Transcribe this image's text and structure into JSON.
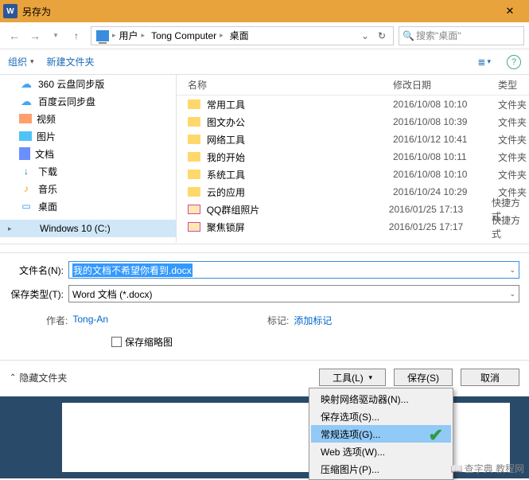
{
  "title": "另存为",
  "breadcrumb": {
    "items": [
      "用户",
      "Tong Computer",
      "桌面"
    ]
  },
  "search": {
    "placeholder": "搜索\"桌面\""
  },
  "toolbar": {
    "organize": "组织",
    "newfolder": "新建文件夹"
  },
  "tree": {
    "items": [
      {
        "label": "360 云盘同步版"
      },
      {
        "label": "百度云同步盘"
      },
      {
        "label": "视频"
      },
      {
        "label": "图片"
      },
      {
        "label": "文档"
      },
      {
        "label": "下载"
      },
      {
        "label": "音乐"
      },
      {
        "label": "桌面"
      },
      {
        "label": "Windows 10 (C:)"
      }
    ]
  },
  "columns": {
    "name": "名称",
    "date": "修改日期",
    "type": "类型"
  },
  "rows": [
    {
      "name": "常用工具",
      "date": "2016/10/08 10:10",
      "type": "文件夹"
    },
    {
      "name": "图文办公",
      "date": "2016/10/08 10:39",
      "type": "文件夹"
    },
    {
      "name": "网络工具",
      "date": "2016/10/12 10:41",
      "type": "文件夹"
    },
    {
      "name": "我的开始",
      "date": "2016/10/08 10:11",
      "type": "文件夹"
    },
    {
      "name": "系统工具",
      "date": "2016/10/08 10:10",
      "type": "文件夹"
    },
    {
      "name": "云的应用",
      "date": "2016/10/24 10:29",
      "type": "文件夹"
    },
    {
      "name": "QQ群组照片",
      "date": "2016/01/25 17:13",
      "type": "快捷方式"
    },
    {
      "name": "聚焦锁屏",
      "date": "2016/01/25 17:17",
      "type": "快捷方式"
    }
  ],
  "filename": {
    "label": "文件名(N):",
    "value": "我的文档不希望你看到.docx"
  },
  "filetype": {
    "label": "保存类型(T):",
    "value": "Word 文档 (*.docx)"
  },
  "meta": {
    "author_lbl": "作者:",
    "author_val": "Tong-An",
    "tags_lbl": "标记:",
    "tags_val": "添加标记"
  },
  "thumbnail_chk": "保存缩略图",
  "hide_folders": "隐藏文件夹",
  "buttons": {
    "tools": "工具(L)",
    "save": "保存(S)",
    "cancel": "取消"
  },
  "tools_menu": {
    "items": [
      "映射网络驱动器(N)...",
      "保存选项(S)...",
      "常规选项(G)...",
      "Web 选项(W)...",
      "压缩图片(P)..."
    ],
    "highlighted": 2
  },
  "watermark": "查字典 教程网"
}
